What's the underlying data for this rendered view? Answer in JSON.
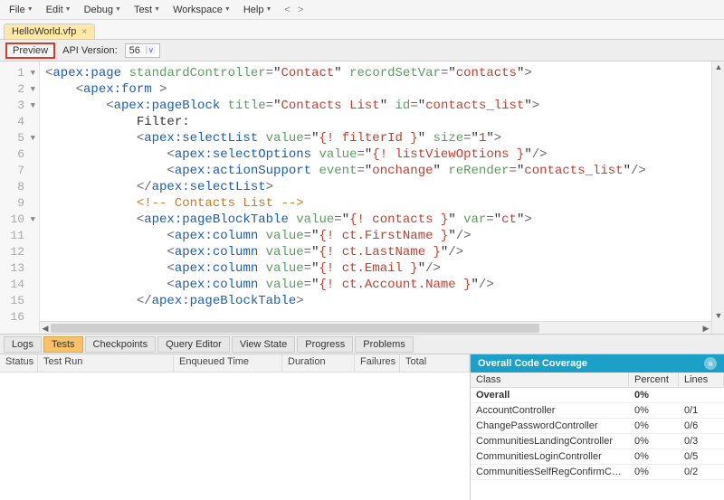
{
  "menu": {
    "items": [
      "File",
      "Edit",
      "Debug",
      "Test",
      "Workspace",
      "Help"
    ]
  },
  "file_tab": {
    "name": "HelloWorld.vfp"
  },
  "toolbar": {
    "preview": "Preview",
    "api_label": "API Version:",
    "api_value": "56"
  },
  "code_lines": [
    {
      "n": 1,
      "fold": true,
      "segs": [
        [
          "<",
          "punc"
        ],
        [
          "apex:page",
          "tag"
        ],
        [
          " ",
          "text"
        ],
        [
          "standardController",
          "attr"
        ],
        [
          "=",
          "punc"
        ],
        [
          "\"",
          "text"
        ],
        [
          "Contact",
          "str"
        ],
        [
          "\"",
          "text"
        ],
        [
          " ",
          "text"
        ],
        [
          "recordSetVar",
          "attr"
        ],
        [
          "=",
          "punc"
        ],
        [
          "\"",
          "text"
        ],
        [
          "contacts",
          "str"
        ],
        [
          "\"",
          "text"
        ],
        [
          ">",
          "punc"
        ]
      ]
    },
    {
      "n": 2,
      "fold": true,
      "segs": [
        [
          "    <",
          "punc"
        ],
        [
          "apex:form",
          "tag"
        ],
        [
          " >",
          "punc"
        ]
      ]
    },
    {
      "n": 3,
      "fold": true,
      "segs": [
        [
          "        <",
          "punc"
        ],
        [
          "apex:pageBlock",
          "tag"
        ],
        [
          " ",
          "text"
        ],
        [
          "title",
          "attr"
        ],
        [
          "=",
          "punc"
        ],
        [
          "\"",
          "text"
        ],
        [
          "Contacts List",
          "str"
        ],
        [
          "\"",
          "text"
        ],
        [
          " ",
          "text"
        ],
        [
          "id",
          "attr"
        ],
        [
          "=",
          "punc"
        ],
        [
          "\"",
          "text"
        ],
        [
          "contacts_list",
          "str"
        ],
        [
          "\"",
          "text"
        ],
        [
          ">",
          "punc"
        ]
      ]
    },
    {
      "n": 4,
      "fold": false,
      "segs": [
        [
          "            Filter:",
          "text"
        ]
      ]
    },
    {
      "n": 5,
      "fold": true,
      "segs": [
        [
          "            <",
          "punc"
        ],
        [
          "apex:selectList",
          "tag"
        ],
        [
          " ",
          "text"
        ],
        [
          "value",
          "attr"
        ],
        [
          "=",
          "punc"
        ],
        [
          "\"",
          "text"
        ],
        [
          "{! filterId }",
          "str"
        ],
        [
          "\"",
          "text"
        ],
        [
          " ",
          "text"
        ],
        [
          "size",
          "attr"
        ],
        [
          "=",
          "punc"
        ],
        [
          "\"",
          "text"
        ],
        [
          "1",
          "str"
        ],
        [
          "\"",
          "text"
        ],
        [
          ">",
          "punc"
        ]
      ]
    },
    {
      "n": 6,
      "fold": false,
      "segs": [
        [
          "                <",
          "punc"
        ],
        [
          "apex:selectOptions",
          "tag"
        ],
        [
          " ",
          "text"
        ],
        [
          "value",
          "attr"
        ],
        [
          "=",
          "punc"
        ],
        [
          "\"",
          "text"
        ],
        [
          "{! listViewOptions }",
          "str"
        ],
        [
          "\"",
          "text"
        ],
        [
          "/>",
          "punc"
        ]
      ]
    },
    {
      "n": 7,
      "fold": false,
      "segs": [
        [
          "                <",
          "punc"
        ],
        [
          "apex:actionSupport",
          "tag"
        ],
        [
          " ",
          "text"
        ],
        [
          "event",
          "attr"
        ],
        [
          "=",
          "punc"
        ],
        [
          "\"",
          "text"
        ],
        [
          "onchange",
          "str"
        ],
        [
          "\"",
          "text"
        ],
        [
          " ",
          "text"
        ],
        [
          "reRender",
          "attr"
        ],
        [
          "=",
          "punc"
        ],
        [
          "\"",
          "text"
        ],
        [
          "contacts_list",
          "str"
        ],
        [
          "\"",
          "text"
        ],
        [
          "/>",
          "punc"
        ]
      ]
    },
    {
      "n": 8,
      "fold": false,
      "segs": [
        [
          "            </",
          "punc"
        ],
        [
          "apex:selectList",
          "tag"
        ],
        [
          ">",
          "punc"
        ]
      ]
    },
    {
      "n": 9,
      "fold": false,
      "segs": [
        [
          "            <!-- Contacts List -->",
          "comment"
        ]
      ]
    },
    {
      "n": 10,
      "fold": true,
      "segs": [
        [
          "            <",
          "punc"
        ],
        [
          "apex:pageBlockTable",
          "tag"
        ],
        [
          " ",
          "text"
        ],
        [
          "value",
          "attr"
        ],
        [
          "=",
          "punc"
        ],
        [
          "\"",
          "text"
        ],
        [
          "{! contacts }",
          "str"
        ],
        [
          "\"",
          "text"
        ],
        [
          " ",
          "text"
        ],
        [
          "var",
          "attr"
        ],
        [
          "=",
          "punc"
        ],
        [
          "\"",
          "text"
        ],
        [
          "ct",
          "str"
        ],
        [
          "\"",
          "text"
        ],
        [
          ">",
          "punc"
        ]
      ]
    },
    {
      "n": 11,
      "fold": false,
      "segs": [
        [
          "                <",
          "punc"
        ],
        [
          "apex:column",
          "tag"
        ],
        [
          " ",
          "text"
        ],
        [
          "value",
          "attr"
        ],
        [
          "=",
          "punc"
        ],
        [
          "\"",
          "text"
        ],
        [
          "{! ct.FirstName }",
          "str"
        ],
        [
          "\"",
          "text"
        ],
        [
          "/>",
          "punc"
        ]
      ]
    },
    {
      "n": 12,
      "fold": false,
      "segs": [
        [
          "                <",
          "punc"
        ],
        [
          "apex:column",
          "tag"
        ],
        [
          " ",
          "text"
        ],
        [
          "value",
          "attr"
        ],
        [
          "=",
          "punc"
        ],
        [
          "\"",
          "text"
        ],
        [
          "{! ct.LastName }",
          "str"
        ],
        [
          "\"",
          "text"
        ],
        [
          "/>",
          "punc"
        ]
      ]
    },
    {
      "n": 13,
      "fold": false,
      "segs": [
        [
          "                <",
          "punc"
        ],
        [
          "apex:column",
          "tag"
        ],
        [
          " ",
          "text"
        ],
        [
          "value",
          "attr"
        ],
        [
          "=",
          "punc"
        ],
        [
          "\"",
          "text"
        ],
        [
          "{! ct.Email }",
          "str"
        ],
        [
          "\"",
          "text"
        ],
        [
          "/>",
          "punc"
        ]
      ]
    },
    {
      "n": 14,
      "fold": false,
      "segs": [
        [
          "                <",
          "punc"
        ],
        [
          "apex:column",
          "tag"
        ],
        [
          " ",
          "text"
        ],
        [
          "value",
          "attr"
        ],
        [
          "=",
          "punc"
        ],
        [
          "\"",
          "text"
        ],
        [
          "{! ct.Account.Name }",
          "str"
        ],
        [
          "\"",
          "text"
        ],
        [
          "/>",
          "punc"
        ]
      ]
    },
    {
      "n": 15,
      "fold": false,
      "segs": [
        [
          "            </",
          "punc"
        ],
        [
          "apex:pageBlockTable",
          "tag"
        ],
        [
          ">",
          "punc"
        ]
      ]
    },
    {
      "n": 16,
      "fold": false,
      "segs": [
        [
          "",
          "text"
        ]
      ]
    }
  ],
  "panel_tabs": [
    "Logs",
    "Tests",
    "Checkpoints",
    "Query Editor",
    "View State",
    "Progress",
    "Problems"
  ],
  "panel_active": 1,
  "tests_headers": [
    "Status",
    "Test Run",
    "Enqueued Time",
    "Duration",
    "Failures",
    "Total"
  ],
  "coverage": {
    "title": "Overall Code Coverage",
    "headers": [
      "Class",
      "Percent",
      "Lines"
    ],
    "rows": [
      {
        "cls": "Overall",
        "pct": "0%",
        "lines": "",
        "bold": true
      },
      {
        "cls": "AccountController",
        "pct": "0%",
        "lines": "0/1"
      },
      {
        "cls": "ChangePasswordController",
        "pct": "0%",
        "lines": "0/6"
      },
      {
        "cls": "CommunitiesLandingController",
        "pct": "0%",
        "lines": "0/3"
      },
      {
        "cls": "CommunitiesLoginController",
        "pct": "0%",
        "lines": "0/5"
      },
      {
        "cls": "CommunitiesSelfRegConfirmController",
        "pct": "0%",
        "lines": "0/2"
      }
    ]
  }
}
